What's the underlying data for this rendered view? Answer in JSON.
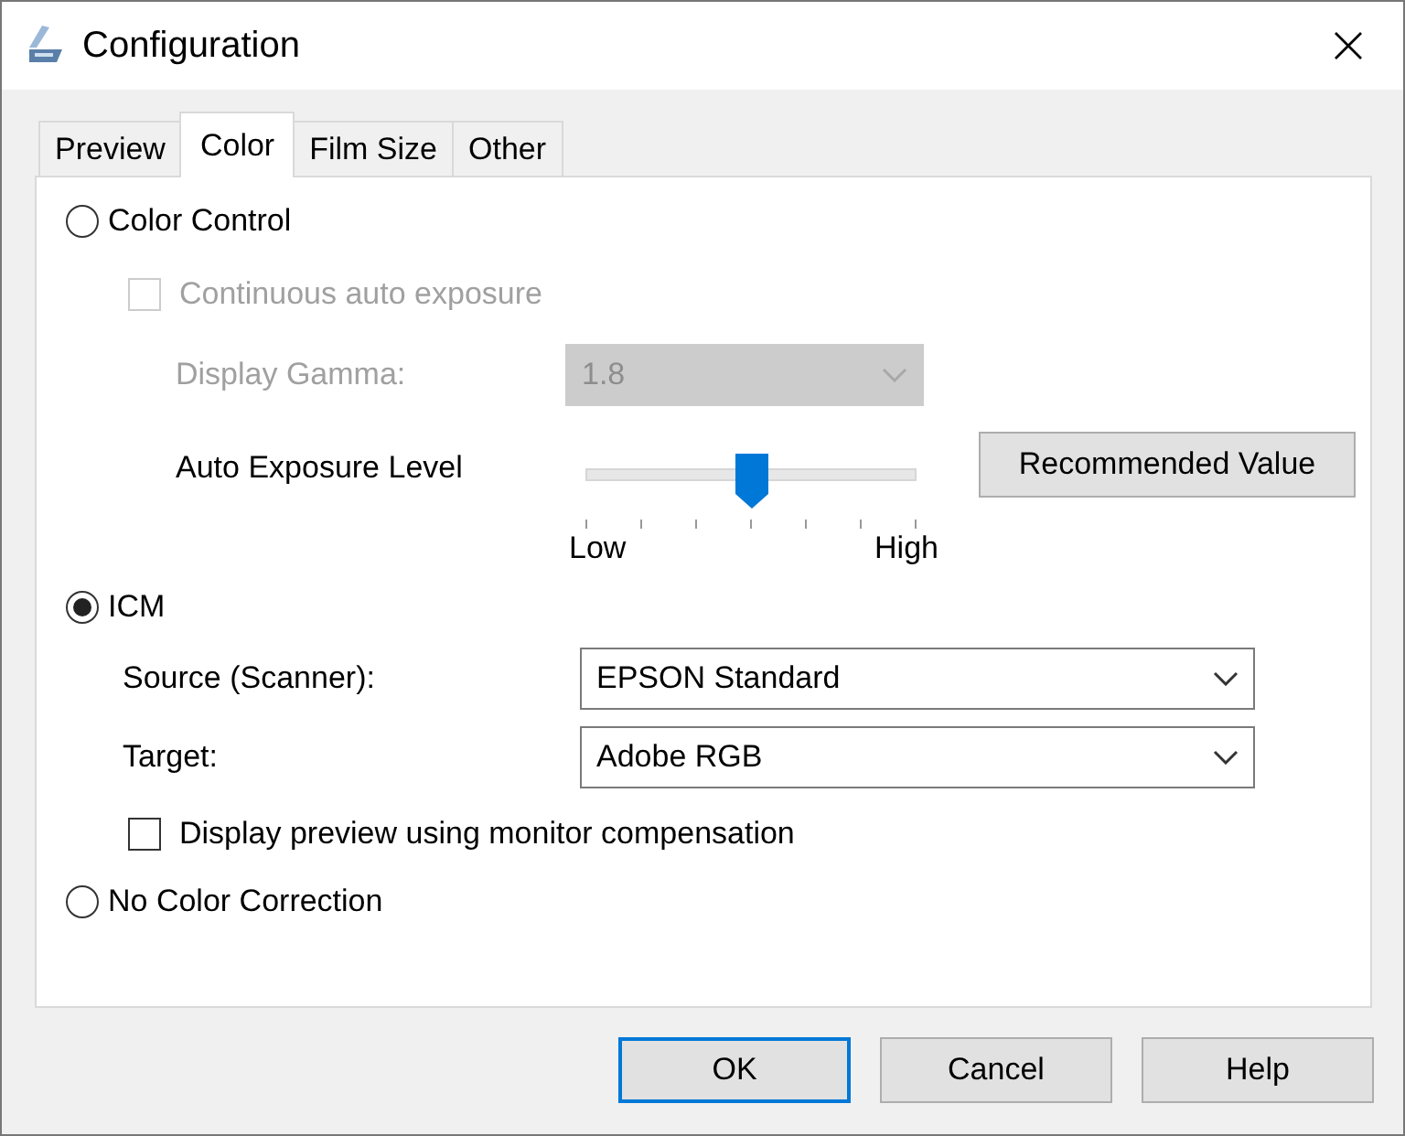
{
  "window": {
    "title": "Configuration"
  },
  "tabs": [
    {
      "label": "Preview",
      "selected": false
    },
    {
      "label": "Color",
      "selected": true
    },
    {
      "label": "Film Size",
      "selected": false
    },
    {
      "label": "Other",
      "selected": false
    }
  ],
  "color_control": {
    "label": "Color Control",
    "selected": false,
    "auto_exposure_checkbox": {
      "label": "Continuous auto exposure",
      "checked": false,
      "disabled": true
    },
    "display_gamma": {
      "label": "Display Gamma:",
      "value": "1.8",
      "disabled": true
    },
    "auto_exposure_level": {
      "label": "Auto Exposure Level",
      "level": 0.5,
      "low_label": "Low",
      "high_label": "High"
    },
    "recommended_button": "Recommended Value"
  },
  "icm": {
    "label": "ICM",
    "selected": true,
    "source": {
      "label": "Source (Scanner):",
      "value": "EPSON Standard"
    },
    "target": {
      "label": "Target:",
      "value": "Adobe RGB"
    },
    "monitor_checkbox": {
      "label": "Display preview using monitor compensation",
      "checked": false
    }
  },
  "no_color_correction": {
    "label": "No Color Correction",
    "selected": false
  },
  "buttons": [
    {
      "label": "OK",
      "default": true
    },
    {
      "label": "Cancel",
      "default": false
    },
    {
      "label": "Help",
      "default": false
    }
  ]
}
